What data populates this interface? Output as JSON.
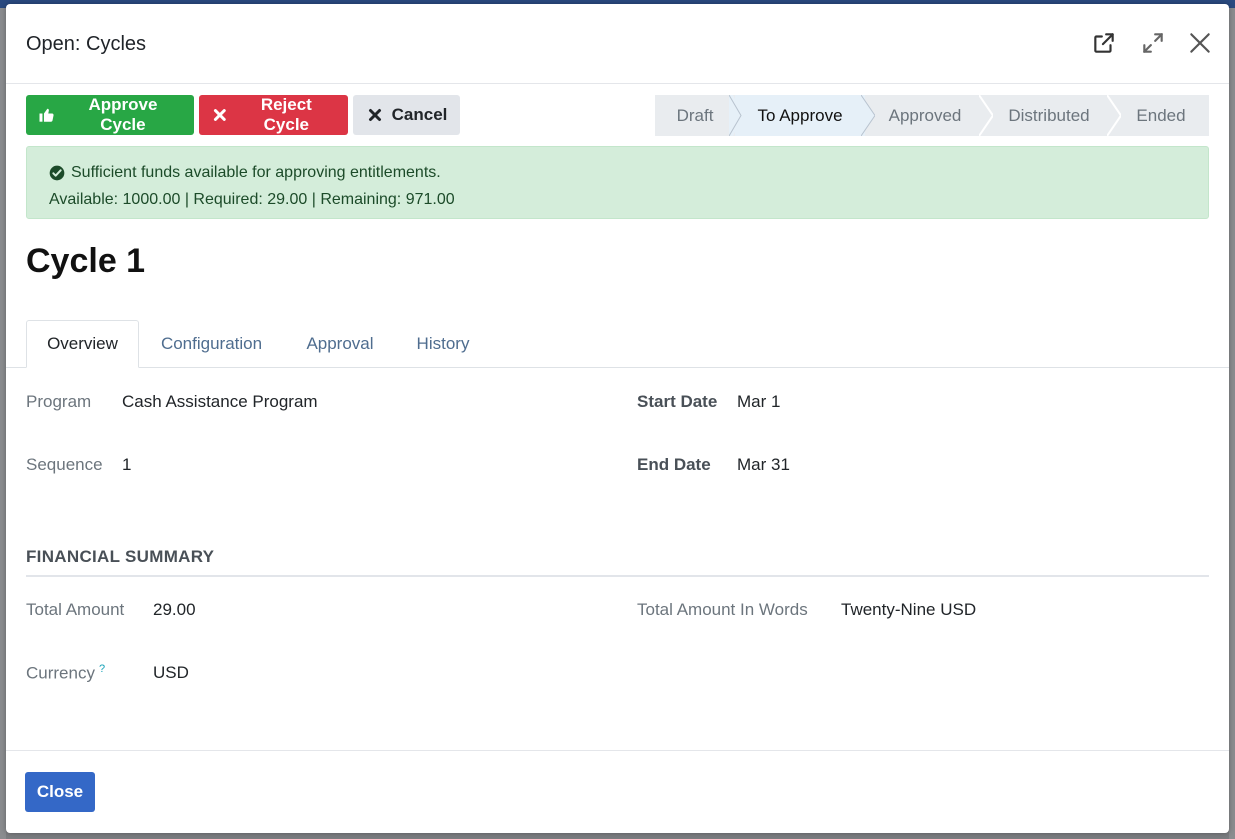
{
  "modal": {
    "title": "Open: Cycles"
  },
  "actions": {
    "approve_label": "Approve Cycle",
    "reject_label": "Reject Cycle",
    "cancel_label": "Cancel"
  },
  "status": {
    "stages": [
      "Draft",
      "To Approve",
      "Approved",
      "Distributed",
      "Ended"
    ],
    "active": "To Approve"
  },
  "alert": {
    "message": "Sufficient funds available for approving entitlements.",
    "details": "Available: 1000.00 | Required: 29.00 | Remaining: 971.00"
  },
  "record": {
    "title": "Cycle 1"
  },
  "tabs": [
    "Overview",
    "Configuration",
    "Approval",
    "History"
  ],
  "overview": {
    "program_label": "Program",
    "program_value": "Cash Assistance Program",
    "sequence_label": "Sequence",
    "sequence_value": "1",
    "start_date_label": "Start Date",
    "start_date_value": "Mar 1",
    "end_date_label": "End Date",
    "end_date_value": "Mar 31"
  },
  "financial": {
    "section_title": "FINANCIAL SUMMARY",
    "total_amount_label": "Total Amount",
    "total_amount_value": "29.00",
    "total_words_label": "Total Amount In Words",
    "total_words_value": "Twenty-Nine USD",
    "currency_label": "Currency",
    "currency_help": "?",
    "currency_value": "USD"
  },
  "footer": {
    "close_label": "Close"
  },
  "colors": {
    "approve": "#28a745",
    "reject": "#dc3545",
    "primary": "#3468c7",
    "alert_bg": "#d4edda"
  }
}
